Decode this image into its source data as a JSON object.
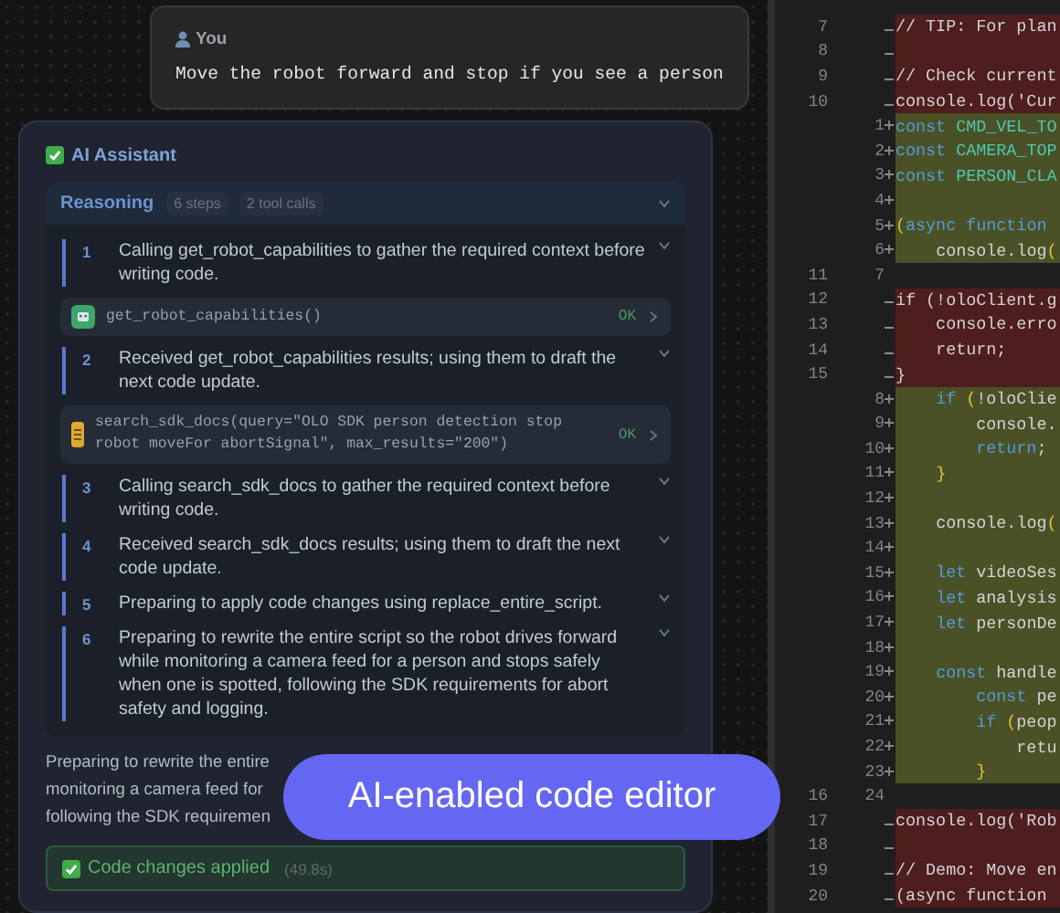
{
  "chat": {
    "user_message": {
      "author": "You",
      "text": "Move the robot forward and stop if you see a person"
    },
    "assistant": {
      "title": "AI Assistant",
      "reasoning": {
        "title": "Reasoning",
        "badges": [
          "6 steps",
          "2 tool calls"
        ],
        "expanded": true,
        "items": [
          {
            "kind": "step",
            "number": "1",
            "text": "Calling get_robot_capabilities to gather the required context before writing code.",
            "expanded": false
          },
          {
            "kind": "tool",
            "color": "#3fa66a",
            "call": "get_robot_capabilities()",
            "status": "OK"
          },
          {
            "kind": "step",
            "number": "2",
            "text": "Received get_robot_capabilities results; using them to draft the next code update.",
            "expanded": false
          },
          {
            "kind": "tool",
            "color": "#e0a82e",
            "call": "search_sdk_docs(query=\"OLO SDK person detection stop robot moveFor abortSignal\", max_results=\"200\")",
            "status": "OK"
          },
          {
            "kind": "step",
            "number": "3",
            "text": "Calling search_sdk_docs to gather the required context before writing code.",
            "expanded": false
          },
          {
            "kind": "step",
            "number": "4",
            "text": "Received search_sdk_docs results; using them to draft the next code update.",
            "expanded": false
          },
          {
            "kind": "step",
            "number": "5",
            "text": "Preparing to apply code changes using replace_entire_script.",
            "expanded": false
          },
          {
            "kind": "step",
            "number": "6",
            "text": "Preparing to rewrite the entire script so the robot drives forward while monitoring a camera feed for a person and stops safely when one is spotted, following the SDK requirements for abort safety and logging.",
            "expanded": false
          }
        ]
      },
      "summary_lines": [
        "Preparing to rewrite the entire",
        "monitoring a camera feed for",
        "following the SDK requiremen"
      ],
      "result": {
        "text": "Code changes applied",
        "duration": "(49.8s)"
      }
    }
  },
  "editor": {
    "rows": [
      {
        "kind": "removed",
        "old": "7",
        "code": "// TIP: For plan"
      },
      {
        "kind": "removed",
        "old": "8"
      },
      {
        "kind": "removed",
        "old": "9",
        "code": "// Check current"
      },
      {
        "kind": "removed",
        "old": "10",
        "code": "console.log('Cur"
      },
      {
        "kind": "added",
        "new": "1",
        "code": "const CMD_VEL_TO"
      },
      {
        "kind": "added",
        "new": "2",
        "code": "const CAMERA_TOP"
      },
      {
        "kind": "added",
        "new": "3",
        "code": "const PERSON_CLA"
      },
      {
        "kind": "added",
        "new": "4"
      },
      {
        "kind": "added",
        "new": "5",
        "code": "(async function"
      },
      {
        "kind": "added",
        "new": "6",
        "code": "    console.log("
      },
      {
        "kind": "context",
        "old": "11",
        "new": "7"
      },
      {
        "kind": "removed",
        "old": "12",
        "code": "if (!oloClient.g"
      },
      {
        "kind": "removed",
        "old": "13",
        "code": "    console.erro"
      },
      {
        "kind": "removed",
        "old": "14",
        "code": "    return;"
      },
      {
        "kind": "removed",
        "old": "15",
        "code": "}"
      },
      {
        "kind": "added",
        "new": "8",
        "code": "    if (!oloClie"
      },
      {
        "kind": "added",
        "new": "9",
        "code": "        console."
      },
      {
        "kind": "added",
        "new": "10",
        "code": "        return;"
      },
      {
        "kind": "added",
        "new": "11",
        "code": "    }"
      },
      {
        "kind": "added",
        "new": "12"
      },
      {
        "kind": "added",
        "new": "13",
        "code": "    console.log("
      },
      {
        "kind": "added",
        "new": "14"
      },
      {
        "kind": "added",
        "new": "15",
        "code": "    let videoSes"
      },
      {
        "kind": "added",
        "new": "16",
        "code": "    let analysis"
      },
      {
        "kind": "added",
        "new": "17",
        "code": "    let personDe"
      },
      {
        "kind": "added",
        "new": "18"
      },
      {
        "kind": "added",
        "new": "19",
        "code": "    const handle"
      },
      {
        "kind": "added",
        "new": "20",
        "code": "        const pe"
      },
      {
        "kind": "added",
        "new": "21",
        "code": "        if (peop"
      },
      {
        "kind": "added",
        "new": "22",
        "code": "            retu"
      },
      {
        "kind": "added",
        "new": "23",
        "code": "        }"
      },
      {
        "kind": "context",
        "old": "16",
        "new": "24"
      },
      {
        "kind": "removed",
        "old": "17",
        "code": "console.log('Rob"
      },
      {
        "kind": "removed",
        "old": "18"
      },
      {
        "kind": "removed",
        "old": "19",
        "code": "// Demo: Move en"
      },
      {
        "kind": "removed",
        "old": "20",
        "code": "(async function"
      }
    ]
  },
  "caption": "AI-enabled code editor"
}
